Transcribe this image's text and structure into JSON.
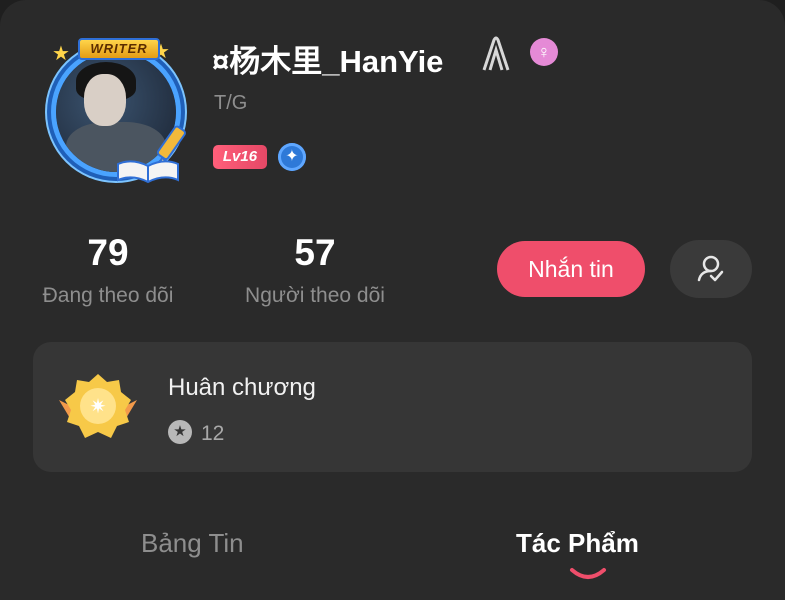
{
  "profile": {
    "username": "¤杨木里_HanYie",
    "subtitle": "T/G",
    "level": "Lv16",
    "avatar_frame_label": "WRITER"
  },
  "stats": {
    "following_count": "79",
    "following_label": "Đang theo dõi",
    "followers_count": "57",
    "followers_label": "Người theo dõi"
  },
  "actions": {
    "message_label": "Nhắn tin"
  },
  "medal": {
    "title": "Huân chương",
    "count": "12"
  },
  "tabs": [
    {
      "label": "Bảng Tin",
      "active": false
    },
    {
      "label": "Tác Phẩm",
      "active": true
    }
  ],
  "colors": {
    "accent": "#ef4e6b",
    "background": "#2a2a2a",
    "card": "#363636",
    "muted_text": "#8e8e8e"
  },
  "icons": [
    "paperclip-icon",
    "female-icon",
    "verified-icon",
    "follow-status-icon",
    "medal-icon",
    "star-coin-icon",
    "pen-icon",
    "book-icon"
  ]
}
